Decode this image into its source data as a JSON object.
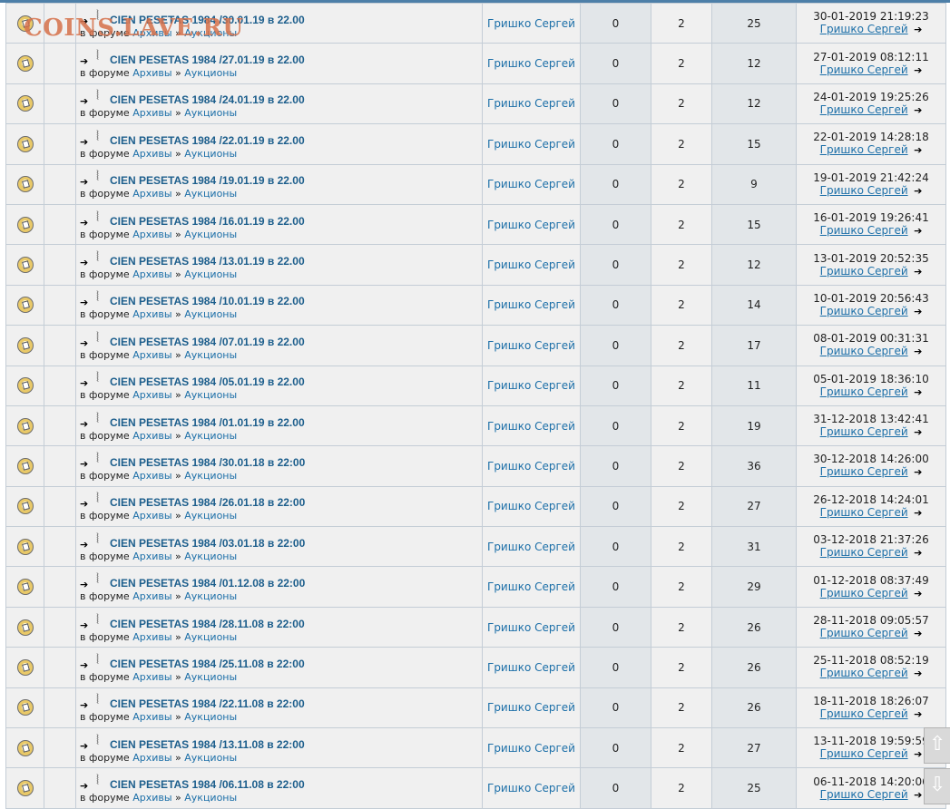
{
  "watermark": "COINS.LAVE.RU",
  "forum_prefix": "в форуме",
  "breadcrumb_sep": "»",
  "go_glyph": "➔",
  "clip_glyph": "𝍐",
  "colors": {
    "link": "#1c6fa8",
    "title": "#1c5e8c",
    "grid": "#c4cdd6",
    "cell_bg": "#f0f0f0",
    "alt_cell_bg": "#e2e6e9"
  },
  "topics": [
    {
      "title": "CIEN PESETAS 1984 /30.01.19 в 22.00",
      "forum": "Архивы",
      "subforum": "Аукционы",
      "author": "Гришко Сергей",
      "replies": "0",
      "participants": "2",
      "views": "25",
      "last_date": "30-01-2019 21:19:23",
      "last_author": "Гришко Сергей"
    },
    {
      "title": "CIEN PESETAS 1984 /27.01.19 в 22.00",
      "forum": "Архивы",
      "subforum": "Аукционы",
      "author": "Гришко Сергей",
      "replies": "0",
      "participants": "2",
      "views": "12",
      "last_date": "27-01-2019 08:12:11",
      "last_author": "Гришко Сергей"
    },
    {
      "title": "CIEN PESETAS 1984 /24.01.19 в 22.00",
      "forum": "Архивы",
      "subforum": "Аукционы",
      "author": "Гришко Сергей",
      "replies": "0",
      "participants": "2",
      "views": "12",
      "last_date": "24-01-2019 19:25:26",
      "last_author": "Гришко Сергей"
    },
    {
      "title": "CIEN PESETAS 1984 /22.01.19 в 22.00",
      "forum": "Архивы",
      "subforum": "Аукционы",
      "author": "Гришко Сергей",
      "replies": "0",
      "participants": "2",
      "views": "15",
      "last_date": "22-01-2019 14:28:18",
      "last_author": "Гришко Сергей"
    },
    {
      "title": "CIEN PESETAS 1984 /19.01.19 в 22.00",
      "forum": "Архивы",
      "subforum": "Аукционы",
      "author": "Гришко Сергей",
      "replies": "0",
      "participants": "2",
      "views": "9",
      "last_date": "19-01-2019 21:42:24",
      "last_author": "Гришко Сергей"
    },
    {
      "title": "CIEN PESETAS 1984 /16.01.19 в 22.00",
      "forum": "Архивы",
      "subforum": "Аукционы",
      "author": "Гришко Сергей",
      "replies": "0",
      "participants": "2",
      "views": "15",
      "last_date": "16-01-2019 19:26:41",
      "last_author": "Гришко Сергей"
    },
    {
      "title": "CIEN PESETAS 1984 /13.01.19 в 22.00",
      "forum": "Архивы",
      "subforum": "Аукционы",
      "author": "Гришко Сергей",
      "replies": "0",
      "participants": "2",
      "views": "12",
      "last_date": "13-01-2019 20:52:35",
      "last_author": "Гришко Сергей"
    },
    {
      "title": "CIEN PESETAS 1984 /10.01.19 в 22.00",
      "forum": "Архивы",
      "subforum": "Аукционы",
      "author": "Гришко Сергей",
      "replies": "0",
      "participants": "2",
      "views": "14",
      "last_date": "10-01-2019 20:56:43",
      "last_author": "Гришко Сергей"
    },
    {
      "title": "CIEN PESETAS 1984 /07.01.19 в 22.00",
      "forum": "Архивы",
      "subforum": "Аукционы",
      "author": "Гришко Сергей",
      "replies": "0",
      "participants": "2",
      "views": "17",
      "last_date": "08-01-2019 00:31:31",
      "last_author": "Гришко Сергей"
    },
    {
      "title": "CIEN PESETAS 1984 /05.01.19 в 22.00",
      "forum": "Архивы",
      "subforum": "Аукционы",
      "author": "Гришко Сергей",
      "replies": "0",
      "participants": "2",
      "views": "11",
      "last_date": "05-01-2019 18:36:10",
      "last_author": "Гришко Сергей"
    },
    {
      "title": "CIEN PESETAS 1984 /01.01.19 в 22.00",
      "forum": "Архивы",
      "subforum": "Аукционы",
      "author": "Гришко Сергей",
      "replies": "0",
      "participants": "2",
      "views": "19",
      "last_date": "31-12-2018 13:42:41",
      "last_author": "Гришко Сергей"
    },
    {
      "title": "CIEN PESETAS 1984 /30.01.18 в 22:00",
      "forum": "Архивы",
      "subforum": "Аукционы",
      "author": "Гришко Сергей",
      "replies": "0",
      "participants": "2",
      "views": "36",
      "last_date": "30-12-2018 14:26:00",
      "last_author": "Гришко Сергей"
    },
    {
      "title": "CIEN PESETAS 1984 /26.01.18 в 22:00",
      "forum": "Архивы",
      "subforum": "Аукционы",
      "author": "Гришко Сергей",
      "replies": "0",
      "participants": "2",
      "views": "27",
      "last_date": "26-12-2018 14:24:01",
      "last_author": "Гришко Сергей"
    },
    {
      "title": "CIEN PESETAS 1984 /03.01.18 в 22:00",
      "forum": "Архивы",
      "subforum": "Аукционы",
      "author": "Гришко Сергей",
      "replies": "0",
      "participants": "2",
      "views": "31",
      "last_date": "03-12-2018 21:37:26",
      "last_author": "Гришко Сергей"
    },
    {
      "title": "CIEN PESETAS 1984 /01.12.08 в 22:00",
      "forum": "Архивы",
      "subforum": "Аукционы",
      "author": "Гришко Сергей",
      "replies": "0",
      "participants": "2",
      "views": "29",
      "last_date": "01-12-2018 08:37:49",
      "last_author": "Гришко Сергей"
    },
    {
      "title": "CIEN PESETAS 1984 /28.11.08 в 22:00",
      "forum": "Архивы",
      "subforum": "Аукционы",
      "author": "Гришко Сергей",
      "replies": "0",
      "participants": "2",
      "views": "26",
      "last_date": "28-11-2018 09:05:57",
      "last_author": "Гришко Сергей"
    },
    {
      "title": "CIEN PESETAS 1984 /25.11.08 в 22:00",
      "forum": "Архивы",
      "subforum": "Аукционы",
      "author": "Гришко Сергей",
      "replies": "0",
      "participants": "2",
      "views": "26",
      "last_date": "25-11-2018 08:52:19",
      "last_author": "Гришко Сергей"
    },
    {
      "title": "CIEN PESETAS 1984 /22.11.08 в 22:00",
      "forum": "Архивы",
      "subforum": "Аукционы",
      "author": "Гришко Сергей",
      "replies": "0",
      "participants": "2",
      "views": "26",
      "last_date": "18-11-2018 18:26:07",
      "last_author": "Гришко Сергей"
    },
    {
      "title": "CIEN PESETAS 1984 /13.11.08 в 22:00",
      "forum": "Архивы",
      "subforum": "Аукционы",
      "author": "Гришко Сергей",
      "replies": "0",
      "participants": "2",
      "views": "27",
      "last_date": "13-11-2018 19:59:59",
      "last_author": "Гришко Сергей"
    },
    {
      "title": "CIEN PESETAS 1984 /06.11.08 в 22:00",
      "forum": "Архивы",
      "subforum": "Аукционы",
      "author": "Гришко Сергей",
      "replies": "0",
      "participants": "2",
      "views": "25",
      "last_date": "06-11-2018 14:20:06",
      "last_author": "Гришко Сергей"
    }
  ]
}
